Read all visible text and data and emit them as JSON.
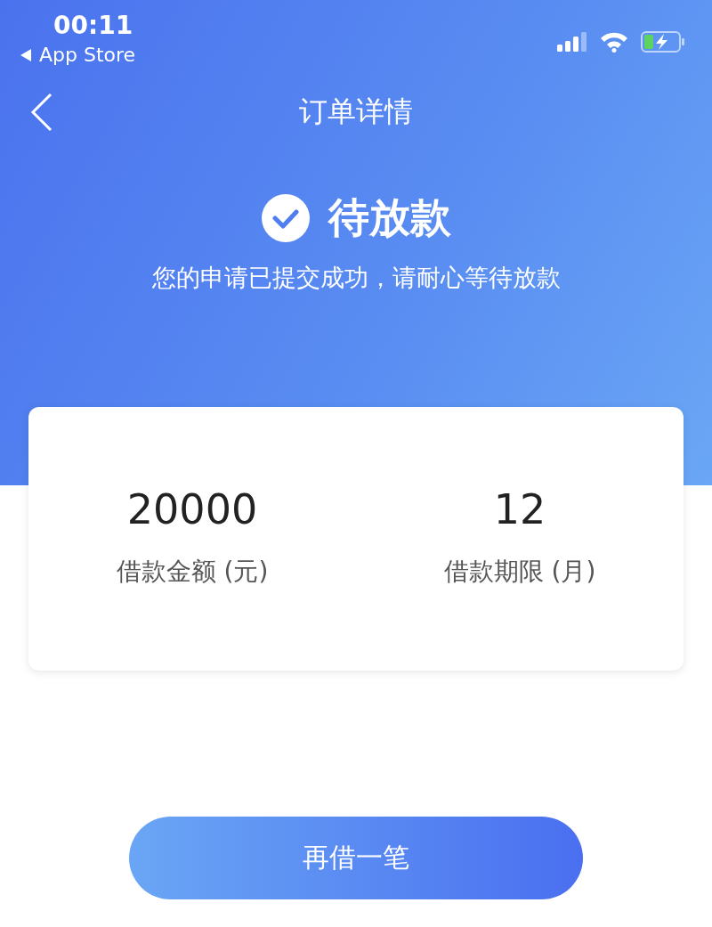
{
  "status_bar": {
    "time": "00:11",
    "back_app": "App Store"
  },
  "nav": {
    "title": "订单详情"
  },
  "status": {
    "title": "待放款",
    "message": "您的申请已提交成功，请耐心等待放款"
  },
  "summary": [
    {
      "value": "20000",
      "label": "借款金额 (元)"
    },
    {
      "value": "12",
      "label": "借款期限 (月)"
    }
  ],
  "button": {
    "label": "再借一笔"
  }
}
